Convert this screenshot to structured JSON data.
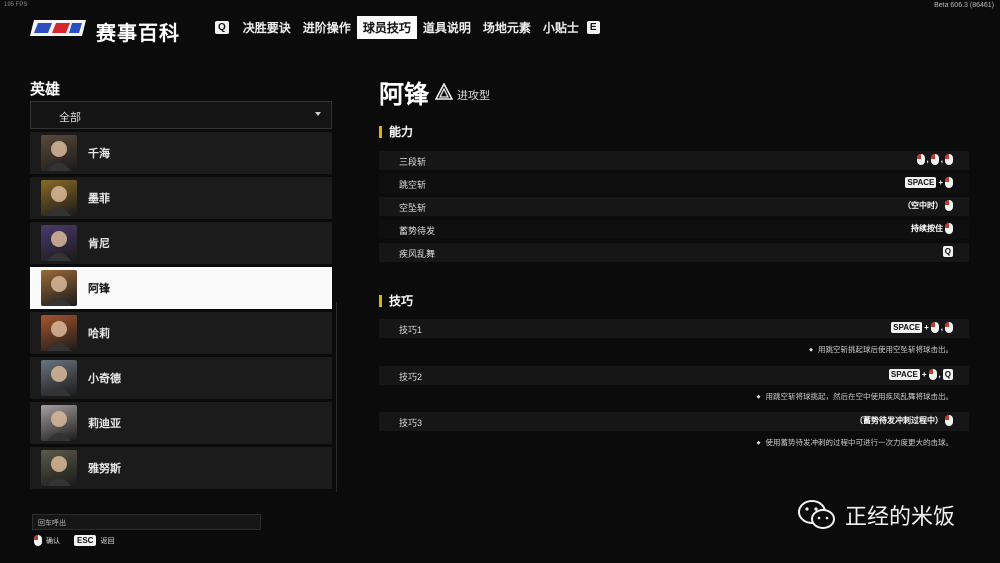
{
  "fps": "195 FPS",
  "build": "Beta 606.3 (86461)",
  "app_title": "赛事百科",
  "nav": {
    "left_key": "Q",
    "right_key": "E",
    "tabs": [
      {
        "label": "决胜要诀",
        "active": false
      },
      {
        "label": "进阶操作",
        "active": false
      },
      {
        "label": "球员技巧",
        "active": true
      },
      {
        "label": "道具说明",
        "active": false
      },
      {
        "label": "场地元素",
        "active": false
      },
      {
        "label": "小贴士",
        "active": false
      }
    ]
  },
  "left": {
    "heading": "英雄",
    "filter_value": "全部",
    "heroes": [
      {
        "name": "千海",
        "selected": false,
        "color": "#5b4a3a"
      },
      {
        "name": "墨菲",
        "selected": false,
        "color": "#8a6a25"
      },
      {
        "name": "肯尼",
        "selected": false,
        "color": "#4a3a6a"
      },
      {
        "name": "阿锋",
        "selected": true,
        "color": "#9a6a3a"
      },
      {
        "name": "哈莉",
        "selected": false,
        "color": "#a8552c"
      },
      {
        "name": "小奇德",
        "selected": false,
        "color": "#6a7480"
      },
      {
        "name": "莉迪亚",
        "selected": false,
        "color": "#a7a0a0"
      },
      {
        "name": "雅努斯",
        "selected": false,
        "color": "#5a5a4a"
      }
    ],
    "chat_placeholder": "回车呼出",
    "confirm_label": "确认",
    "back_key": "ESC",
    "back_label": "返回"
  },
  "detail": {
    "hero_name": "阿锋",
    "role": "进攻型",
    "abilities_title": "能力",
    "abilities": [
      {
        "label": "三段斩",
        "inputs": [
          "mouse-left",
          "sep:,",
          "mouse-left",
          "sep:,",
          "mouse-left"
        ]
      },
      {
        "label": "跳空斩",
        "inputs": [
          "key:SPACE",
          "sep:+",
          "mouse-left"
        ]
      },
      {
        "label": "空坠斩",
        "inputs": [
          "text:（空中时）",
          "mouse-left"
        ]
      },
      {
        "label": "蓄势待发",
        "inputs": [
          "text:持续按住",
          "mouse-left"
        ]
      },
      {
        "label": "疾风乱舞",
        "inputs": [
          "key:Q"
        ]
      }
    ],
    "skills_title": "技巧",
    "skills": [
      {
        "label": "技巧1",
        "inputs": [
          "key:SPACE",
          "sep:+",
          "mouse-left",
          "sep:,",
          "mouse-left"
        ],
        "tip": "用跳空斩挑起球后使用空坠斩将球击出。"
      },
      {
        "label": "技巧2",
        "inputs": [
          "key:SPACE",
          "sep:+",
          "mouse-left",
          "sep:,",
          "key:Q"
        ],
        "tip": "用跳空斩将球挑起，然后在空中使用疾风乱舞将球击出。"
      },
      {
        "label": "技巧3",
        "inputs": [
          "text:（蓄势待发冲刺过程中）",
          "mouse-left"
        ],
        "tip": "使用蓄势待发冲刺的过程中可进行一次力度更大的击球。"
      }
    ]
  },
  "watermark": "正经的米饭",
  "colors": {
    "accent": "#e0b100",
    "selected_bg": "#fafafa",
    "mouse_button": "#c0392b"
  }
}
